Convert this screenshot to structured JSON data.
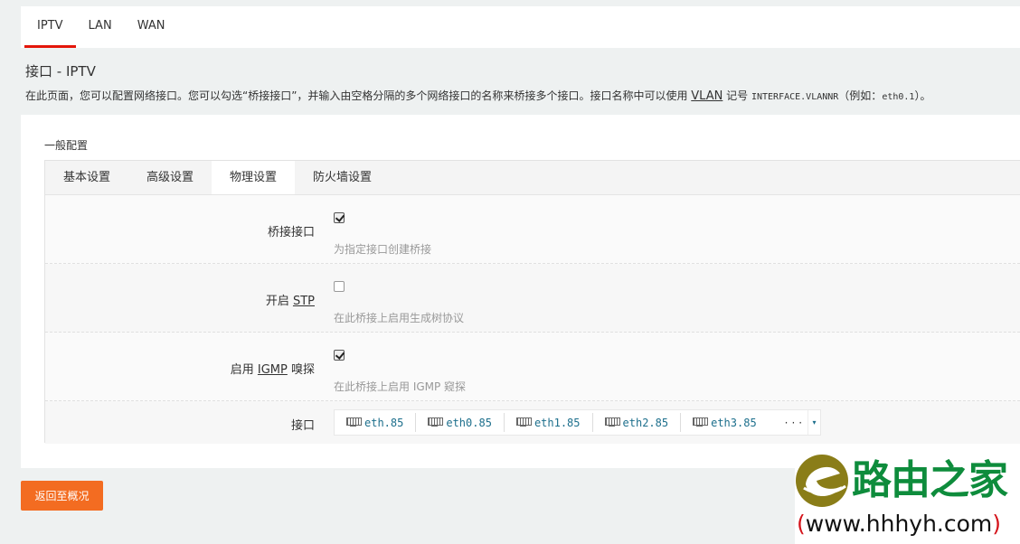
{
  "topnav": {
    "tabs": [
      {
        "label": "IPTV"
      },
      {
        "label": "LAN"
      },
      {
        "label": "WAN"
      }
    ]
  },
  "page": {
    "title": "接口 - IPTV",
    "desc_part1": "在此页面，您可以配置网络接口。您可以勾选“桥接接口”，并输入由空格分隔的多个网络接口的名称来桥接多个接口。接口名称中可以使用 ",
    "desc_vlan": "VLAN",
    "desc_part2": " 记号 ",
    "desc_mono": "INTERFACE.VLANNR",
    "desc_part3": "（例如：",
    "desc_example": "eth0.1",
    "desc_part4": "）。"
  },
  "general": {
    "legend": "一般配置",
    "subtabs": [
      {
        "label": "基本设置"
      },
      {
        "label": "高级设置"
      },
      {
        "label": "物理设置"
      },
      {
        "label": "防火墙设置"
      }
    ],
    "active_subtab": "物理设置"
  },
  "fields": {
    "bridge": {
      "label": "桥接接口",
      "hint": "为指定接口创建桥接",
      "checked": true
    },
    "stp": {
      "label_prefix": "开启 ",
      "label_abbr": "STP",
      "hint": "在此桥接上启用生成树协议",
      "checked": false
    },
    "igmp": {
      "label_prefix": "启用 ",
      "label_abbr": "IGMP",
      "label_suffix": " 嗅探",
      "hint": "在此桥接上启用 IGMP 窥探",
      "checked": true
    },
    "interfaces": {
      "label": "接口",
      "items": [
        "eth.85",
        "eth0.85",
        "eth1.85",
        "eth2.85",
        "eth3.85"
      ],
      "more": "···",
      "caret": "▾"
    }
  },
  "actions": {
    "back_label": "返回至概况"
  },
  "watermark": {
    "name": "路由之家",
    "url": "www.hhhyh.com",
    "paren_open": "(",
    "paren_close": ")"
  },
  "colors": {
    "accent": "#e4160a",
    "button": "#f36c21",
    "watermark_green": "#0e8c3c"
  }
}
